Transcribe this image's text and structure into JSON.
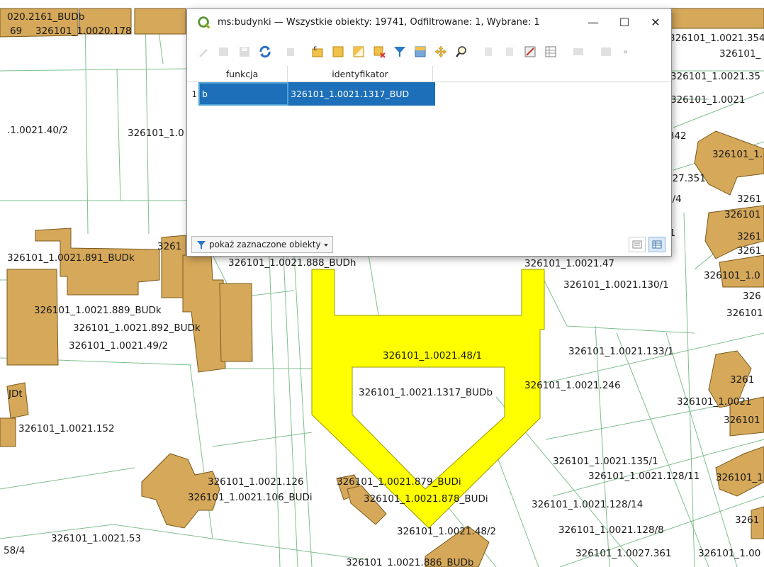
{
  "window": {
    "title": "ms:budynki — Wszystkie obiekty: 19741, Odfiltrowane: 1, Wybrane: 1",
    "minimize_glyph": "—",
    "maximize_glyph": "☐",
    "close_glyph": "✕",
    "more_glyph": "»"
  },
  "toolbar": {
    "icons": [
      "pencil-icon",
      "multi-edit-icon",
      "save-icon",
      "reload-icon",
      "add-feature-icon",
      "delete-icon",
      "select-expression-icon",
      "select-all-icon",
      "invert-selection-icon",
      "deselect-icon",
      "filter-icon",
      "move-top-icon",
      "pan-icon",
      "zoom-icon",
      "copy-icon",
      "paste-icon",
      "field-calc-icon",
      "conditional-format-icon",
      "dock-icon",
      "actions-icon"
    ]
  },
  "table": {
    "columns": [
      "funkcja",
      "identyfikator"
    ],
    "rows": [
      {
        "num": "1",
        "funkcja": "b",
        "identyfikator": "326101_1.0021.1317_BUD"
      }
    ]
  },
  "statusbar": {
    "filter_label": "pokaż zaznaczone obiekty"
  },
  "map": {
    "labels": [
      "020.2161_BUDb",
      "69",
      "326101_1.0020.178",
      "326101_1.0021.354",
      "326101_",
      "326101_1.0021.35",
      "326101_1.0021",
      ".1.0021.40/2",
      "326101_1.0",
      "7.342",
      "326101_1.",
      "027.351",
      "6/4",
      "3261",
      "326101",
      "3261",
      "3261",
      "326101_1.0",
      "326",
      "326101",
      "/1",
      "326101_1.0021.891_BUDk",
      "3261",
      "326101_1.0021.888_BUDh",
      "326101_1.0021.47",
      "326101_1.0021.130/1",
      "326101_1.0021.889_BUDk",
      "326101_1.0021.892_BUDk",
      "326101_1.0021.49/2",
      "326101_1.0021.48/1",
      "326101_1.0021.133/1",
      "326101_1.0021.1317_BUDb",
      "326101_1.0021.246",
      "JDt",
      "326101_1.0021.152",
      "3261",
      "326101_1.0021",
      "326101",
      "326101_1.0021.135/1",
      "326101_1.0021.128/11",
      "326101_1.0",
      "326101_1.0021.126",
      "326101_1.0021.106_BUDi",
      "326101_1.0021.879_BUDi",
      "326101_1.0021.878_BUDi",
      "326101_1.0021.128/14",
      "3261",
      "326101_1.0021.48/2",
      "326101_1.0021.128/8",
      "326101_1.0021.53",
      "58/4",
      "326101_1.0021.886_BUDb",
      "326101_1.0027.361",
      "326101_1.00"
    ]
  },
  "colors": {
    "building": "#d5a85a",
    "selected": "#ffff00",
    "parcel_line": "#7fbf8f",
    "selection_blue": "#1c6fb8"
  }
}
